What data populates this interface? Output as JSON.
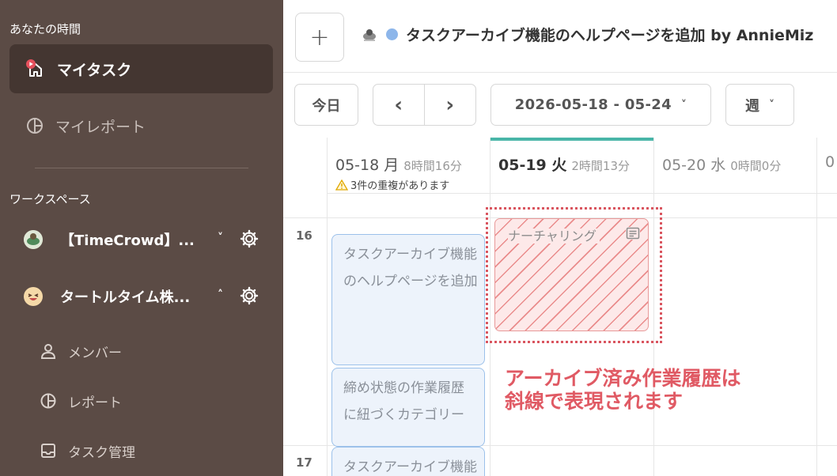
{
  "sidebar": {
    "section_your_time": "あなたの時間",
    "my_tasks": "マイタスク",
    "my_report": "マイレポート",
    "section_workspace": "ワークスペース",
    "workspaces": [
      {
        "name": "【TimeCrowd】...",
        "chevron": "˅"
      },
      {
        "name": "タートルタイム株...",
        "chevron": "˄"
      }
    ],
    "sub_items": [
      "メンバー",
      "レポート",
      "タスク管理"
    ]
  },
  "header": {
    "add_label": "+",
    "task_title": "タスクアーカイブ機能のヘルプページを追加 by AnnieMiz"
  },
  "toolbar": {
    "today": "今日",
    "prev": "‹",
    "next": "›",
    "range": "2026-05-18 - 05-24",
    "range_chevron": "˅",
    "view": "週",
    "view_chevron": "˅"
  },
  "calendar": {
    "days": [
      {
        "date": "05-18 月",
        "duration": "8時間16分",
        "warning": "3件の重複があります"
      },
      {
        "date": "05-19 火",
        "duration": "2時間13分"
      },
      {
        "date": "05-20 水",
        "duration": "0時間0分"
      },
      {
        "date": "0"
      }
    ],
    "hours": [
      "16",
      "17"
    ],
    "events": [
      {
        "line1": "タスクアーカイブ機能",
        "line2": "のヘルプページを追加"
      },
      {
        "line1": "締め状態の作業履歴",
        "line2": "に紐づくカテゴリー"
      },
      {
        "line1": "タスクアーカイブ機能"
      }
    ],
    "archived_event": {
      "label": "ナーチャリング"
    },
    "annotation": {
      "line1": "アーカイブ済み作業履歴は",
      "line2": "斜線で表現されます"
    }
  },
  "colors": {
    "sidebar_bg": "#5b4b45",
    "sidebar_active": "#443631",
    "today_accent": "#49b5a8",
    "event_bg": "#edf3fb",
    "event_border": "#9cc1ea",
    "archived_stripe": "#e88282",
    "annotation": "#e05a64"
  }
}
